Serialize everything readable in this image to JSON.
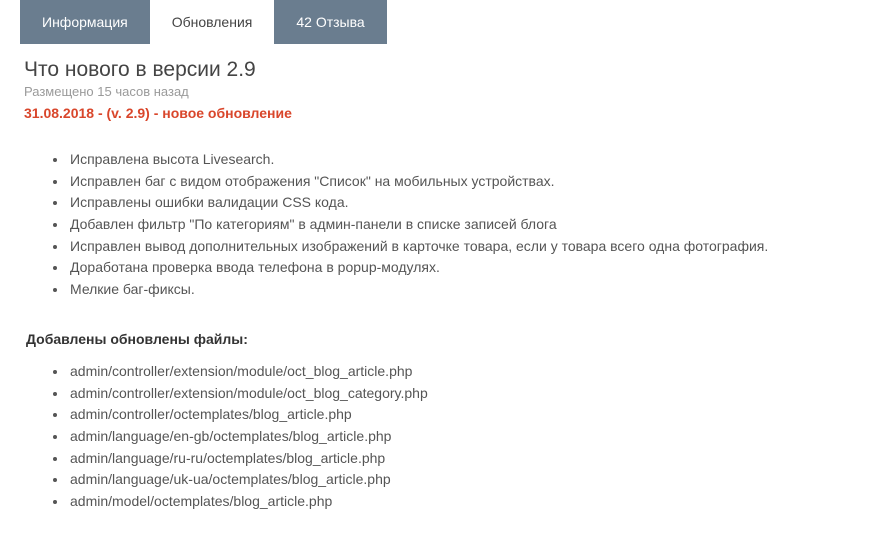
{
  "tabs": [
    {
      "label": "Информация",
      "active": false
    },
    {
      "label": "Обновления",
      "active": true
    },
    {
      "label": "42 Отзыва",
      "active": false
    }
  ],
  "title": "Что нового в версии 2.9",
  "posted": "Размещено 15 часов назад",
  "release_line": "31.08.2018 - (v. 2.9) - новое обновление",
  "changes": [
    "Исправлена высота Livesearch.",
    "Исправлен баг с видом отображения \"Список\" на мобильных устройствах.",
    "Исправлены ошибки валидации CSS кода.",
    "Добавлен фильтр \"По категориям\" в админ-панели в списке записей блога",
    "Исправлен вывод дополнительных изображений в карточке товара, если у товара всего одна фотография.",
    "Доработана проверка ввода телефона в popup-модулях.",
    "Мелкие баг-фиксы."
  ],
  "files_heading": "Добавлены обновлены файлы:",
  "files": [
    "admin/controller/extension/module/oct_blog_article.php",
    "admin/controller/extension/module/oct_blog_category.php",
    "admin/controller/octemplates/blog_article.php",
    "admin/language/en-gb/octemplates/blog_article.php",
    "admin/language/ru-ru/octemplates/blog_article.php",
    "admin/language/uk-ua/octemplates/blog_article.php",
    "admin/model/octemplates/blog_article.php"
  ]
}
